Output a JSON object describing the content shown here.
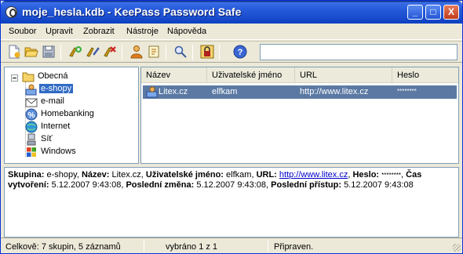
{
  "window": {
    "title": "moje_hesla.kdb - KeePass Password Safe",
    "btn_min": "_",
    "btn_max": "□",
    "btn_close": "X"
  },
  "menu": [
    {
      "label": "Soubor"
    },
    {
      "label": "Upravit"
    },
    {
      "label": "Zobrazit"
    },
    {
      "label": "Nástroje"
    },
    {
      "label": "Nápověda"
    }
  ],
  "toolbar": {
    "search_value": "",
    "icons": [
      "new-db-icon",
      "open-folder-icon",
      "save-icon",
      "add-entry-icon",
      "edit-entry-icon",
      "delete-entry-icon",
      "copy-username-icon",
      "copy-password-icon",
      "find-icon",
      "lock-icon",
      "help-icon"
    ]
  },
  "tree": {
    "root": {
      "label": "Obecná"
    },
    "groups": [
      {
        "label": "e-shopy",
        "icon": "user-card-icon",
        "selected": true
      },
      {
        "label": "e-mail",
        "icon": "mail-icon"
      },
      {
        "label": "Homebanking",
        "icon": "percent-icon"
      },
      {
        "label": "Internet",
        "icon": "globe-icon"
      },
      {
        "label": "Síť",
        "icon": "network-icon"
      },
      {
        "label": "Windows",
        "icon": "windows-icon"
      }
    ]
  },
  "list": {
    "columns": [
      "Název",
      "Uživatelské jméno",
      "URL",
      "Heslo"
    ],
    "rows": [
      {
        "title": "Litex.cz",
        "username": "elfkam",
        "url": "http://www.litex.cz",
        "password": "********"
      }
    ]
  },
  "details": {
    "k_group": "Skupina:",
    "v_group": "e-shopy",
    "k_title": "Název:",
    "v_title": "Litex.cz",
    "k_user": "Uživatelské jméno:",
    "v_user": "elfkam",
    "k_url": "URL:",
    "v_url": "http://www.litex.cz",
    "k_pass": "Heslo:",
    "v_pass": "********",
    "k_created": "Čas vytvoření:",
    "v_created": "5.12.2007 9:43:08",
    "k_modified": "Poslední změna:",
    "v_modified": "5.12.2007 9:43:08",
    "k_accessed": "Poslední přístup:",
    "v_accessed": "5.12.2007 9:43:08"
  },
  "status": {
    "summary": "Celkově: 7 skupin, 5 záznamů",
    "selection": "vybráno 1 z 1",
    "state": "Připraven."
  },
  "colors": {
    "title_bar": "#2459d8",
    "selection": "#5b79a3",
    "tree_selection": "#316ac5",
    "link": "#0000cc"
  }
}
